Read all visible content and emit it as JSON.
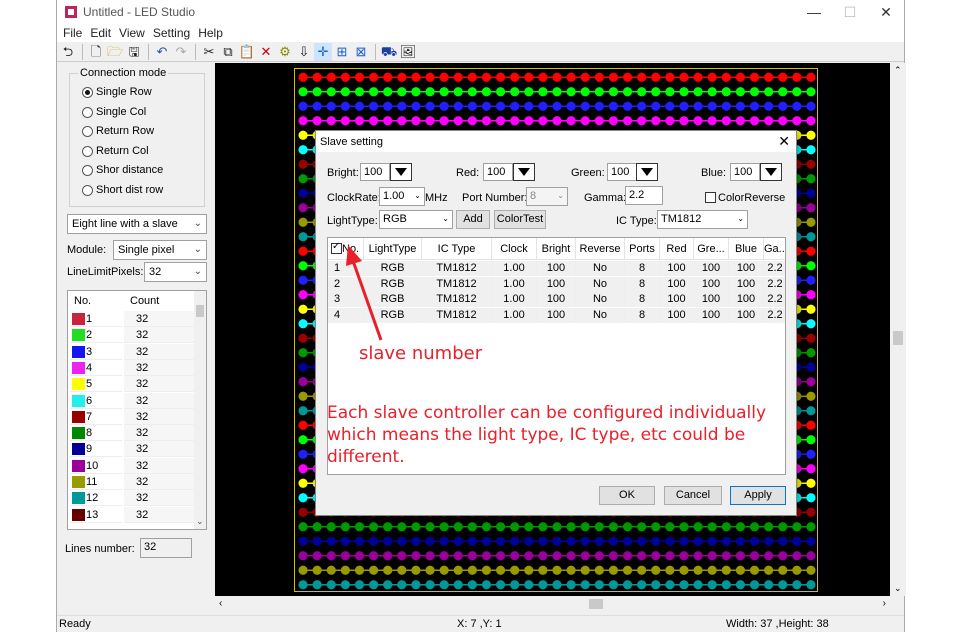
{
  "window": {
    "title": "Untitled - LED Studio",
    "min": "—",
    "max": "☐",
    "close": "✕"
  },
  "menu": [
    "File",
    "Edit",
    "View",
    "Setting",
    "Help"
  ],
  "connection": {
    "legend": "Connection mode",
    "options": [
      "Single Row",
      "Single Col",
      "Return Row",
      "Return Col",
      "Shor distance",
      "Short dist row"
    ],
    "selected_index": 0
  },
  "slave_mode": "Eight line with a slave",
  "module": {
    "label": "Module:",
    "value": "Single pixel"
  },
  "line_limit": {
    "label": "LineLimitPixels:",
    "value": "32"
  },
  "count_list": {
    "headers": [
      "No.",
      "Count"
    ],
    "rows": [
      {
        "no": "1",
        "count": "32",
        "color": "#c8243c"
      },
      {
        "no": "2",
        "count": "32",
        "color": "#22dd22"
      },
      {
        "no": "3",
        "count": "32",
        "color": "#1515ee"
      },
      {
        "no": "4",
        "count": "32",
        "color": "#ee22ee"
      },
      {
        "no": "5",
        "count": "32",
        "color": "#ffff00"
      },
      {
        "no": "6",
        "count": "32",
        "color": "#22eeee"
      },
      {
        "no": "7",
        "count": "32",
        "color": "#990000"
      },
      {
        "no": "8",
        "count": "32",
        "color": "#008800"
      },
      {
        "no": "9",
        "count": "32",
        "color": "#000099"
      },
      {
        "no": "10",
        "count": "32",
        "color": "#990099"
      },
      {
        "no": "11",
        "count": "32",
        "color": "#999900"
      },
      {
        "no": "12",
        "count": "32",
        "color": "#009999"
      },
      {
        "no": "13",
        "count": "32",
        "color": "#660000"
      }
    ]
  },
  "lines_number": {
    "label": "Lines number:",
    "value": "32"
  },
  "canvas": {
    "row_colors": [
      "#ff0000",
      "#00ff00",
      "#2020ff",
      "#ff00ff",
      "#ffff00",
      "#00ffff",
      "#990000",
      "#009900",
      "#000099",
      "#990099",
      "#999900",
      "#009999",
      "#ff0000",
      "#00ff00",
      "#2020ff",
      "#ff00ff",
      "#ffff00",
      "#00ffff",
      "#990000",
      "#009900",
      "#000099",
      "#990099",
      "#999900",
      "#009999",
      "#ff0000",
      "#00ff00",
      "#2020ff",
      "#ff00ff",
      "#ffff00",
      "#00ffff",
      "#990000",
      "#009900",
      "#000099",
      "#990099",
      "#999900",
      "#009999"
    ]
  },
  "status": {
    "left": "Ready",
    "mid": "X: 7 ,Y: 1",
    "right": "Width: 37 ,Height: 38"
  },
  "dialog": {
    "title": "Slave setting",
    "bright": {
      "label": "Bright:",
      "value": "100"
    },
    "red": {
      "label": "Red:",
      "value": "100"
    },
    "green": {
      "label": "Green:",
      "value": "100"
    },
    "blue": {
      "label": "Blue:",
      "value": "100"
    },
    "clockrate": {
      "label": "ClockRate:",
      "value": "1.00",
      "unit": "MHz"
    },
    "port_number": {
      "label": "Port Number:",
      "value": "8"
    },
    "gamma": {
      "label": "Gamma:",
      "value": "2.2"
    },
    "color_reverse": "ColorReverse",
    "lighttype": {
      "label": "LightType:",
      "value": "RGB"
    },
    "add": "Add",
    "colortest": "ColorTest",
    "ictype": {
      "label": "IC Type:",
      "value": "TM1812"
    },
    "table": {
      "headers": [
        "No.",
        "LightType",
        "IC Type",
        "Clock",
        "Bright",
        "Reverse",
        "Ports",
        "Red",
        "Gre...",
        "Blue",
        "Ga..."
      ],
      "rows": [
        [
          "1",
          "RGB",
          "TM1812",
          "1.00",
          "100",
          "No",
          "8",
          "100",
          "100",
          "100",
          "2.2"
        ],
        [
          "2",
          "RGB",
          "TM1812",
          "1.00",
          "100",
          "No",
          "8",
          "100",
          "100",
          "100",
          "2.2"
        ],
        [
          "3",
          "RGB",
          "TM1812",
          "1.00",
          "100",
          "No",
          "8",
          "100",
          "100",
          "100",
          "2.2"
        ],
        [
          "4",
          "RGB",
          "TM1812",
          "1.00",
          "100",
          "No",
          "8",
          "100",
          "100",
          "100",
          "2.2"
        ]
      ]
    },
    "ok": "OK",
    "cancel": "Cancel",
    "apply": "Apply"
  },
  "annotations": {
    "slave_number": "slave number",
    "note_line1": "Each slave controller can be configured individually",
    "note_line2": "which means the light type, IC type, etc could be",
    "note_line3": "different."
  }
}
